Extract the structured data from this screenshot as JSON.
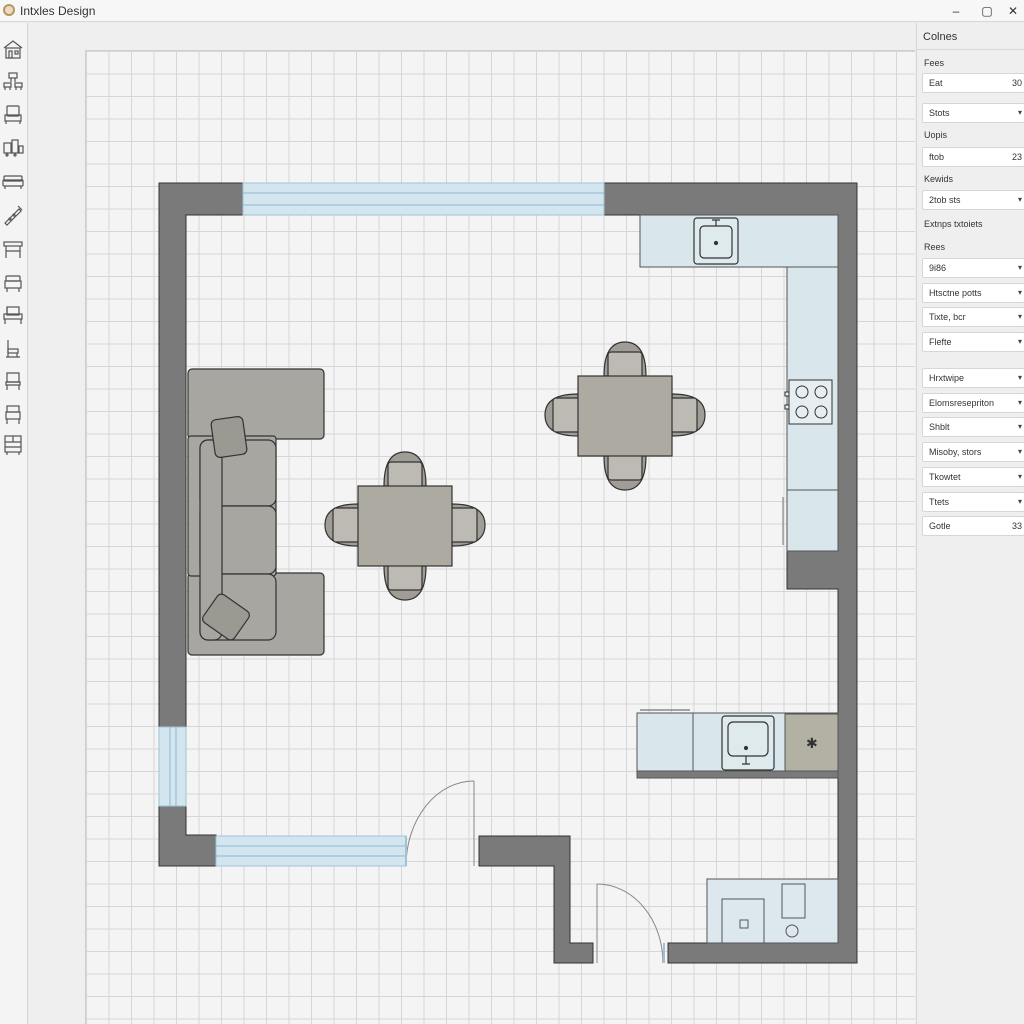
{
  "app": {
    "title": "Intxles Design"
  },
  "window_controls": {
    "minimize": "–",
    "maximize": "▢",
    "close": "✕"
  },
  "toolbar": {
    "tools": [
      {
        "name": "house-tool-icon"
      },
      {
        "name": "dining-set-tool-icon"
      },
      {
        "name": "armchair-tool-icon"
      },
      {
        "name": "appliances-tool-icon"
      },
      {
        "name": "sofa-tool-icon"
      },
      {
        "name": "brush-tool-icon"
      },
      {
        "name": "table-tool-icon"
      },
      {
        "name": "stool-tool-icon"
      },
      {
        "name": "bench-tool-icon"
      },
      {
        "name": "chair-tool-icon"
      },
      {
        "name": "chair-alt-tool-icon"
      },
      {
        "name": "side-chair-tool-icon"
      },
      {
        "name": "cabinet-tool-icon"
      }
    ]
  },
  "panel": {
    "title": "Colnes",
    "section_fees": "Fees",
    "row_eat": {
      "label": "Eat",
      "value": "30"
    },
    "row_stots": {
      "label": "Stots"
    },
    "section_uopis": "Uopis",
    "row_ftob": {
      "label": "ftob",
      "value": "23"
    },
    "section_kewids": "Kewids",
    "row_2tob": {
      "label": "2tob sts"
    },
    "section_extnps": "Extnps txtoiets",
    "section_rees": "Rees",
    "rows_group1": [
      {
        "label": "9i86"
      },
      {
        "label": "Htsctne potts"
      },
      {
        "label": "Tixte, bcr"
      },
      {
        "label": "Flefte"
      }
    ],
    "rows_group2": [
      {
        "label": "Hrxtwipe"
      },
      {
        "label": "Elomsresepriton"
      },
      {
        "label": "Shblt"
      },
      {
        "label": "Misoby, stors"
      },
      {
        "label": "Tkowtet"
      },
      {
        "label": "Ttets"
      }
    ],
    "row_gotle": {
      "label": "Gotle",
      "value": "33"
    },
    "arrow": "▾"
  },
  "colors": {
    "wall": "#7a7a7a",
    "furniture": "#adaba1",
    "sofa": "#a7a6a1",
    "counter": "#d9e6ec",
    "window": "#d3e6ef",
    "grid_line": "#d6d6d6"
  },
  "plan": {
    "range_symbol": "✱"
  }
}
